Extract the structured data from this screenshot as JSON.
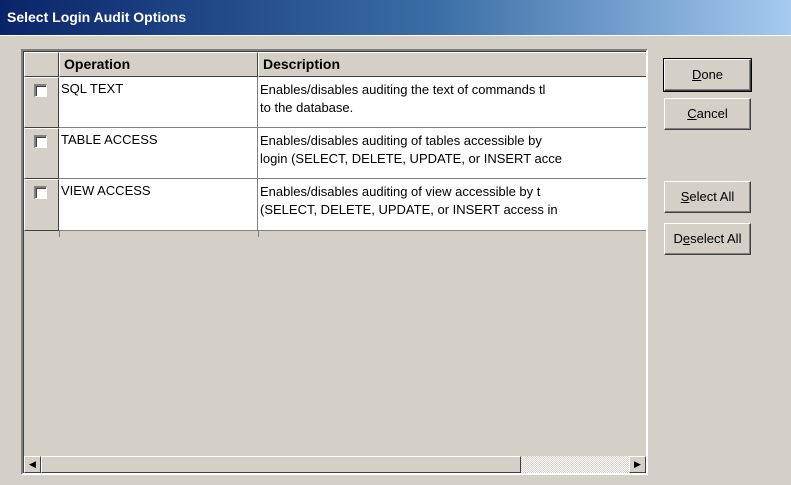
{
  "window": {
    "title": "Select Login Audit Options"
  },
  "grid": {
    "columns": [
      "",
      "Operation",
      "Description"
    ],
    "rows": [
      {
        "checked": false,
        "operation": "SQL TEXT",
        "description_line1": "Enables/disables auditing the text of commands tl",
        "description_line2": "to the database."
      },
      {
        "checked": false,
        "operation": "TABLE ACCESS",
        "description_line1": "Enables/disables auditing of tables accessible by",
        "description_line2": "login (SELECT, DELETE, UPDATE, or INSERT acce"
      },
      {
        "checked": false,
        "operation": "VIEW ACCESS",
        "description_line1": "Enables/disables auditing of view accessible by t",
        "description_line2": "(SELECT, DELETE, UPDATE, or INSERT access in"
      }
    ],
    "scroll_left_glyph": "◀",
    "scroll_right_glyph": "▶"
  },
  "buttons": {
    "done": {
      "mnemonic": "D",
      "rest": "one"
    },
    "cancel": {
      "mnemonic": "C",
      "rest": "ancel"
    },
    "select_all": {
      "mnemonic": "S",
      "rest": "elect All"
    },
    "deselect_all": {
      "pre": "D",
      "mnemonic": "e",
      "rest": "select All"
    }
  }
}
